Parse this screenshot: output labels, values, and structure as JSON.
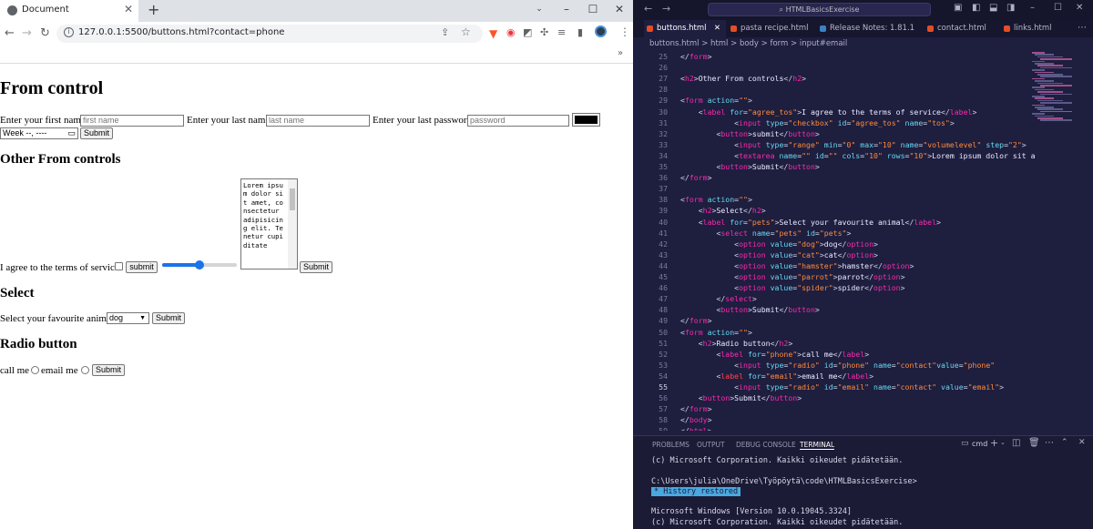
{
  "browser": {
    "tab_title": "Document",
    "url": "127.0.0.1:5500/buttons.html?contact=phone",
    "page": {
      "h1": "From control",
      "first_name_label": "Enter your first name",
      "first_name_placeholder": "first name",
      "last_name_label": "Enter your last name",
      "last_name_placeholder": "last name",
      "password_label": "Enter your last password",
      "password_placeholder": "password",
      "week_value": "Week --, ----",
      "submit1": "Submit",
      "h2_other": "Other From controls",
      "tos_label": "I agree to the terms of service",
      "submit_lower": "submit",
      "textarea_value": "Lorem ipsum dolor sit amet, consectetur adipisicing elit. Tenetur cupiditate",
      "submit2": "Submit",
      "range_value": 5,
      "range_max": 10,
      "h2_select": "Select",
      "pets_label": "Select your favourite animal",
      "pets_selected": "dog",
      "submit3": "Submit",
      "h2_radio": "Radio button",
      "call_label": "call me",
      "email_label": "email me",
      "submit4": "Submit"
    }
  },
  "vscode": {
    "search": "HTMLBasicsExercise",
    "tabs": [
      "buttons.html",
      "pasta recipe.html",
      "Release Notes: 1.81.1",
      "contact.html",
      "links.html"
    ],
    "breadcrumb": "buttons.html > html > body > form > input#email",
    "lines": [
      {
        "n": "25",
        "html": "<span class='br'>&lt;/</span><span class='tg'>form</span><span class='br'>&gt;</span>"
      },
      {
        "n": "26",
        "html": ""
      },
      {
        "n": "27",
        "html": "<span class='br'>&lt;</span><span class='tg'>h2</span><span class='br'>&gt;</span><span class='tx'>Other From controls</span><span class='br'>&lt;/</span><span class='tg'>h2</span><span class='br'>&gt;</span>"
      },
      {
        "n": "28",
        "html": ""
      },
      {
        "n": "29",
        "html": "<span class='br'>&lt;</span><span class='tg'>form</span> <span class='at'>action</span>=<span class='vl'>\"\"</span><span class='br'>&gt;</span>"
      },
      {
        "n": "30",
        "html": "    <span class='br'>&lt;</span><span class='tg'>label</span> <span class='at'>for</span>=<span class='vl'>\"agree_tos\"</span><span class='br'>&gt;</span><span class='tx'>I agree to the terms of service</span><span class='br'>&lt;/</span><span class='tg'>label</span><span class='br'>&gt;</span>"
      },
      {
        "n": "31",
        "html": "            <span class='br'>&lt;</span><span class='tg'>input</span> <span class='at'>type</span>=<span class='vl'>\"checkbox\"</span> <span class='at'>id</span>=<span class='vl'>\"agree_tos\"</span> <span class='at'>name</span>=<span class='vl'>\"tos\"</span><span class='br'>&gt;</span>"
      },
      {
        "n": "32",
        "html": "        <span class='br'>&lt;</span><span class='tg'>button</span><span class='br'>&gt;</span><span class='tx'>submit</span><span class='br'>&lt;/</span><span class='tg'>button</span><span class='br'>&gt;</span>"
      },
      {
        "n": "33",
        "html": "            <span class='br'>&lt;</span><span class='tg'>input</span> <span class='at'>type</span>=<span class='vl'>\"range\"</span> <span class='at'>min</span>=<span class='vl'>\"0\"</span> <span class='at'>max</span>=<span class='vl'>\"10\"</span> <span class='at'>name</span>=<span class='vl'>\"volumelevel\"</span> <span class='at'>step</span>=<span class='vl'>\"2\"</span><span class='br'>&gt;</span>"
      },
      {
        "n": "34",
        "html": "            <span class='br'>&lt;</span><span class='tg'>textarea</span> <span class='at'>name</span>=<span class='vl'>\"\"</span> <span class='at'>id</span>=<span class='vl'>\"\"</span> <span class='at'>cols</span>=<span class='vl'>\"10\"</span> <span class='at'>rows</span>=<span class='vl'>\"10\"</span><span class='br'>&gt;</span><span class='tx'>Lorem ipsum dolor sit a</span>"
      },
      {
        "n": "35",
        "html": "        <span class='br'>&lt;</span><span class='tg'>button</span><span class='br'>&gt;</span><span class='tx'>Submit</span><span class='br'>&lt;/</span><span class='tg'>button</span><span class='br'>&gt;</span>"
      },
      {
        "n": "36",
        "html": "<span class='br'>&lt;/</span><span class='tg'>form</span><span class='br'>&gt;</span>"
      },
      {
        "n": "37",
        "html": ""
      },
      {
        "n": "38",
        "html": "<span class='br'>&lt;</span><span class='tg'>form</span> <span class='at'>action</span>=<span class='vl'>\"\"</span><span class='br'>&gt;</span>"
      },
      {
        "n": "39",
        "html": "    <span class='br'>&lt;</span><span class='tg'>h2</span><span class='br'>&gt;</span><span class='tx'>Select</span><span class='br'>&lt;/</span><span class='tg'>h2</span><span class='br'>&gt;</span>"
      },
      {
        "n": "40",
        "html": "    <span class='br'>&lt;</span><span class='tg'>label</span> <span class='at'>for</span>=<span class='vl'>\"pets\"</span><span class='br'>&gt;</span><span class='tx'>Select your favourite animal</span><span class='br'>&lt;/</span><span class='tg'>label</span><span class='br'>&gt;</span>"
      },
      {
        "n": "41",
        "html": "        <span class='br'>&lt;</span><span class='tg'>select</span> <span class='at'>name</span>=<span class='vl'>\"pets\"</span> <span class='at'>id</span>=<span class='vl'>\"pets\"</span><span class='br'>&gt;</span>"
      },
      {
        "n": "42",
        "html": "            <span class='br'>&lt;</span><span class='tg'>option</span> <span class='at'>value</span>=<span class='vl'>\"dog\"</span><span class='br'>&gt;</span><span class='tx'>dog</span><span class='br'>&lt;/</span><span class='tg'>option</span><span class='br'>&gt;</span>"
      },
      {
        "n": "43",
        "html": "            <span class='br'>&lt;</span><span class='tg'>option</span> <span class='at'>value</span>=<span class='vl'>\"cat\"</span><span class='br'>&gt;</span><span class='tx'>cat</span><span class='br'>&lt;/</span><span class='tg'>option</span><span class='br'>&gt;</span>"
      },
      {
        "n": "44",
        "html": "            <span class='br'>&lt;</span><span class='tg'>option</span> <span class='at'>value</span>=<span class='vl'>\"hamster\"</span><span class='br'>&gt;</span><span class='tx'>hamster</span><span class='br'>&lt;/</span><span class='tg'>option</span><span class='br'>&gt;</span>"
      },
      {
        "n": "45",
        "html": "            <span class='br'>&lt;</span><span class='tg'>option</span> <span class='at'>value</span>=<span class='vl'>\"parrot\"</span><span class='br'>&gt;</span><span class='tx'>parrot</span><span class='br'>&lt;/</span><span class='tg'>option</span><span class='br'>&gt;</span>"
      },
      {
        "n": "46",
        "html": "            <span class='br'>&lt;</span><span class='tg'>option</span> <span class='at'>value</span>=<span class='vl'>\"spider\"</span><span class='br'>&gt;</span><span class='tx'>spider</span><span class='br'>&lt;/</span><span class='tg'>option</span><span class='br'>&gt;</span>"
      },
      {
        "n": "47",
        "html": "        <span class='br'>&lt;/</span><span class='tg'>select</span><span class='br'>&gt;</span>"
      },
      {
        "n": "48",
        "html": "        <span class='br'>&lt;</span><span class='tg'>button</span><span class='br'>&gt;</span><span class='tx'>Submit</span><span class='br'>&lt;/</span><span class='tg'>button</span><span class='br'>&gt;</span>"
      },
      {
        "n": "49",
        "html": "<span class='br'>&lt;/</span><span class='tg'>form</span><span class='br'>&gt;</span>"
      },
      {
        "n": "50",
        "html": "<span class='br'>&lt;</span><span class='tg'>form</span> <span class='at'>action</span>=<span class='vl'>\"\"</span><span class='br'>&gt;</span>"
      },
      {
        "n": "51",
        "html": "    <span class='br'>&lt;</span><span class='tg'>h2</span><span class='br'>&gt;</span><span class='tx'>Radio button</span><span class='br'>&lt;/</span><span class='tg'>h2</span><span class='br'>&gt;</span>"
      },
      {
        "n": "52",
        "html": "        <span class='br'>&lt;</span><span class='tg'>label</span> <span class='at'>for</span>=<span class='vl'>\"phone\"</span><span class='br'>&gt;</span><span class='tx'>call me</span><span class='br'>&lt;/</span><span class='tg'>label</span><span class='br'>&gt;</span>"
      },
      {
        "n": "53",
        "html": "            <span class='br'>&lt;</span><span class='tg'>input</span> <span class='at'>type</span>=<span class='vl'>\"radio\"</span> <span class='at'>id</span>=<span class='vl'>\"phone\"</span> <span class='at'>name</span>=<span class='vl'>\"contact\"</span><span class='at'>value</span>=<span class='vl'>\"phone\"</span>"
      },
      {
        "n": "54",
        "html": "        <span class='br'>&lt;</span><span class='tr'>label</span> <span class='at'>for</span>=<span class='vl'>\"email\"</span><span class='br'>&gt;</span><span class='tx'>email me</span><span class='br'>&lt;/</span><span class='tg'>label</span><span class='br'>&gt;</span>"
      },
      {
        "n": "55",
        "html": "            <span class='br'>&lt;</span><span class='tg'>input</span> <span class='at'>type</span>=<span class='vl'>\"radio\"</span> <span class='at'>id</span>=<span class='vl'>\"email\"</span> <span class='at'>name</span>=<span class='vl'>\"contact\"</span> <span class='at'>value</span>=<span class='vl'>\"email\"</span><span class='br'>&gt;</span>"
      },
      {
        "n": "56",
        "html": "    <span class='br'>&lt;</span><span class='tg'>button</span><span class='br'>&gt;</span><span class='tx'>Submit</span><span class='br'>&lt;/</span><span class='tg'>button</span><span class='br'>&gt;</span>"
      },
      {
        "n": "57",
        "html": "<span class='br'>&lt;/</span><span class='tg'>form</span><span class='br'>&gt;</span>"
      },
      {
        "n": "58",
        "html": "<span class='br'>&lt;/</span><span class='tg'>body</span><span class='br'>&gt;</span>"
      },
      {
        "n": "59",
        "html": "<span class='br'>&lt;/</span><span class='tg'>html</span><span class='br'>&gt;</span>"
      }
    ],
    "panel_tabs": [
      "PROBLEMS",
      "OUTPUT",
      "DEBUG CONSOLE",
      "TERMINAL"
    ],
    "terminal_name": "cmd",
    "terminal": {
      "l1": "(c) Microsoft Corporation. Kaikki oikeudet pidätetään.",
      "l2": "C:\\Users\\julia\\OneDrive\\Työpöytä\\code\\HTMLBasicsExercise>",
      "hist": "History restored",
      "l3": "Microsoft Windows [Version 10.0.19045.3324]",
      "l4": "(c) Microsoft Corporation. Kaikki oikeudet pidätetään."
    }
  }
}
